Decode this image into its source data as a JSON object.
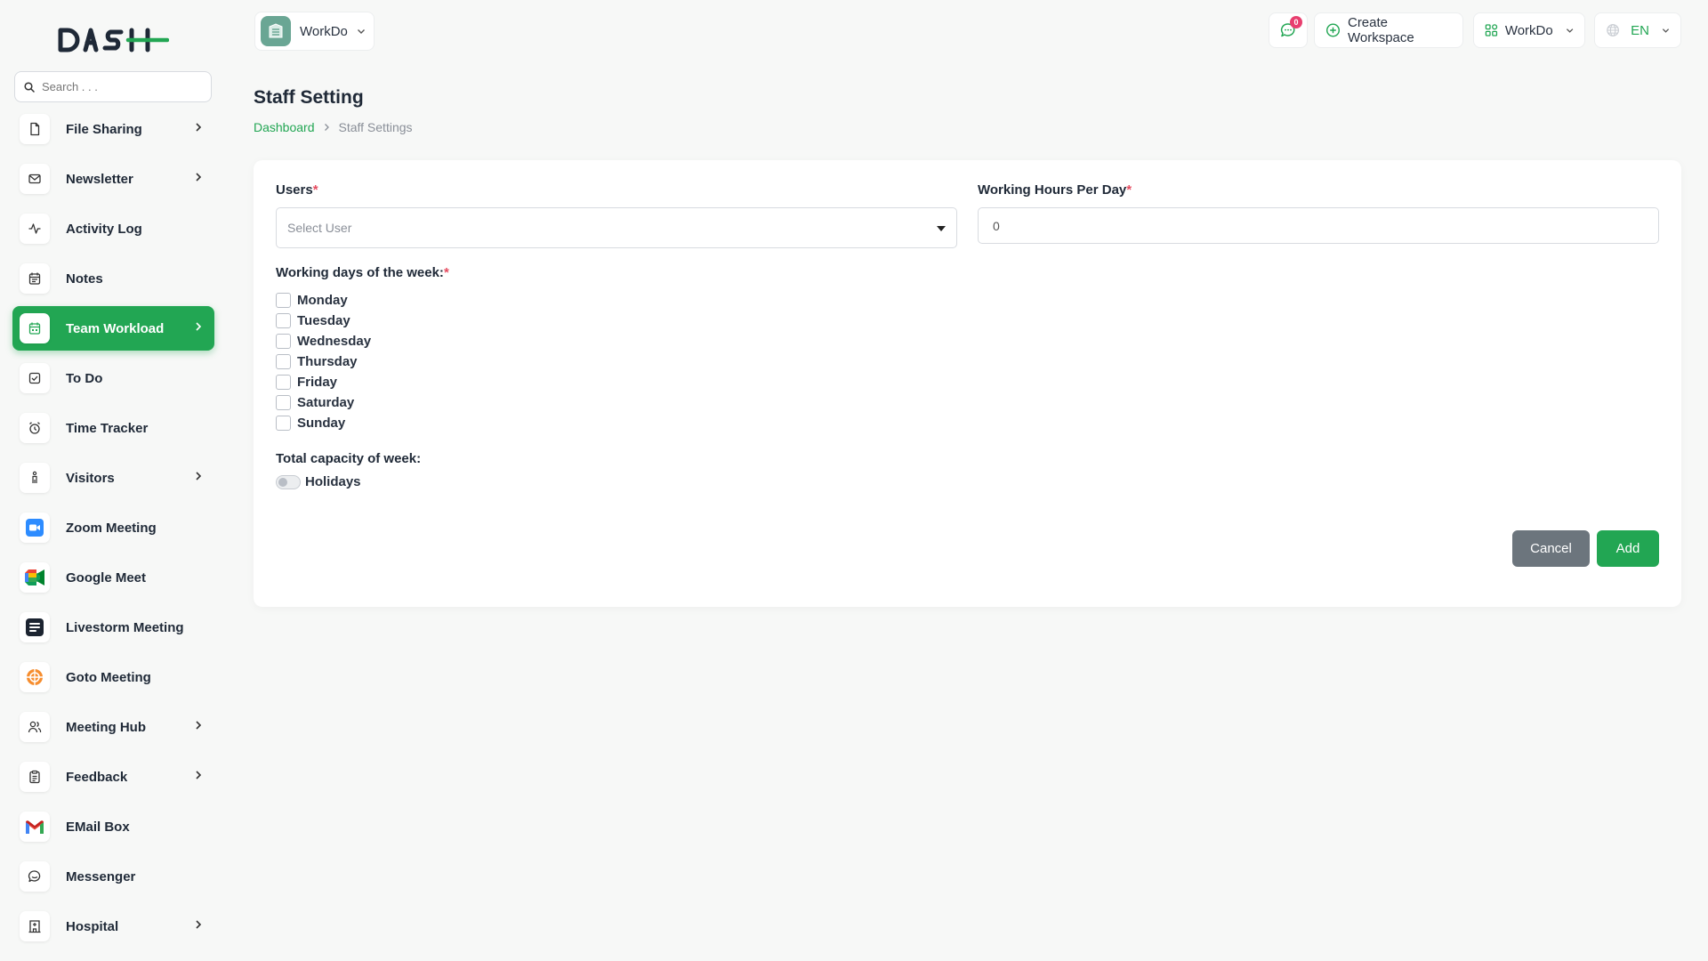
{
  "brand": {
    "logo_text": "DASH",
    "accent": "#22a653"
  },
  "search": {
    "placeholder": "Search . . ."
  },
  "sidebar": {
    "items": [
      {
        "label": "File Sharing",
        "icon": "file-icon",
        "has_submenu": true,
        "active": false
      },
      {
        "label": "Newsletter",
        "icon": "mail-icon",
        "has_submenu": true,
        "active": false
      },
      {
        "label": "Activity Log",
        "icon": "activity-icon",
        "has_submenu": false,
        "active": false
      },
      {
        "label": "Notes",
        "icon": "notes-icon",
        "has_submenu": false,
        "active": false
      },
      {
        "label": "Team Workload",
        "icon": "calendar-icon",
        "has_submenu": true,
        "active": true
      },
      {
        "label": "To Do",
        "icon": "checklist-icon",
        "has_submenu": false,
        "active": false
      },
      {
        "label": "Time Tracker",
        "icon": "alarm-icon",
        "has_submenu": false,
        "active": false
      },
      {
        "label": "Visitors",
        "icon": "person-icon",
        "has_submenu": true,
        "active": false
      },
      {
        "label": "Zoom Meeting",
        "icon": "zoom-icon",
        "has_submenu": false,
        "active": false
      },
      {
        "label": "Google Meet",
        "icon": "google-meet-icon",
        "has_submenu": false,
        "active": false
      },
      {
        "label": "Livestorm Meeting",
        "icon": "livestorm-icon",
        "has_submenu": false,
        "active": false
      },
      {
        "label": "Goto Meeting",
        "icon": "goto-icon",
        "has_submenu": false,
        "active": false
      },
      {
        "label": "Meeting Hub",
        "icon": "users-icon",
        "has_submenu": true,
        "active": false
      },
      {
        "label": "Feedback",
        "icon": "clipboard-icon",
        "has_submenu": true,
        "active": false
      },
      {
        "label": "EMail Box",
        "icon": "gmail-icon",
        "has_submenu": false,
        "active": false
      },
      {
        "label": "Messenger",
        "icon": "chat-icon",
        "has_submenu": false,
        "active": false
      },
      {
        "label": "Hospital",
        "icon": "building-icon",
        "has_submenu": true,
        "active": false
      }
    ]
  },
  "header": {
    "workspace_name": "WorkDo",
    "messages_count": "0",
    "create_workspace_label": "Create Workspace",
    "workspace_dropdown_label": "WorkDo",
    "language": "EN"
  },
  "page": {
    "title": "Staff Setting",
    "breadcrumb": {
      "home": "Dashboard",
      "current": "Staff Settings"
    }
  },
  "form": {
    "users_label": "Users",
    "users_placeholder": "Select User",
    "hours_label": "Working Hours Per Day",
    "hours_value": "0",
    "days_label": "Working days of the week:",
    "days": [
      "Monday",
      "Tuesday",
      "Wednesday",
      "Thursday",
      "Friday",
      "Saturday",
      "Sunday"
    ],
    "capacity_label": "Total capacity of week:",
    "holidays_label": "Holidays",
    "cancel_label": "Cancel",
    "add_label": "Add",
    "required_mark": "*"
  }
}
